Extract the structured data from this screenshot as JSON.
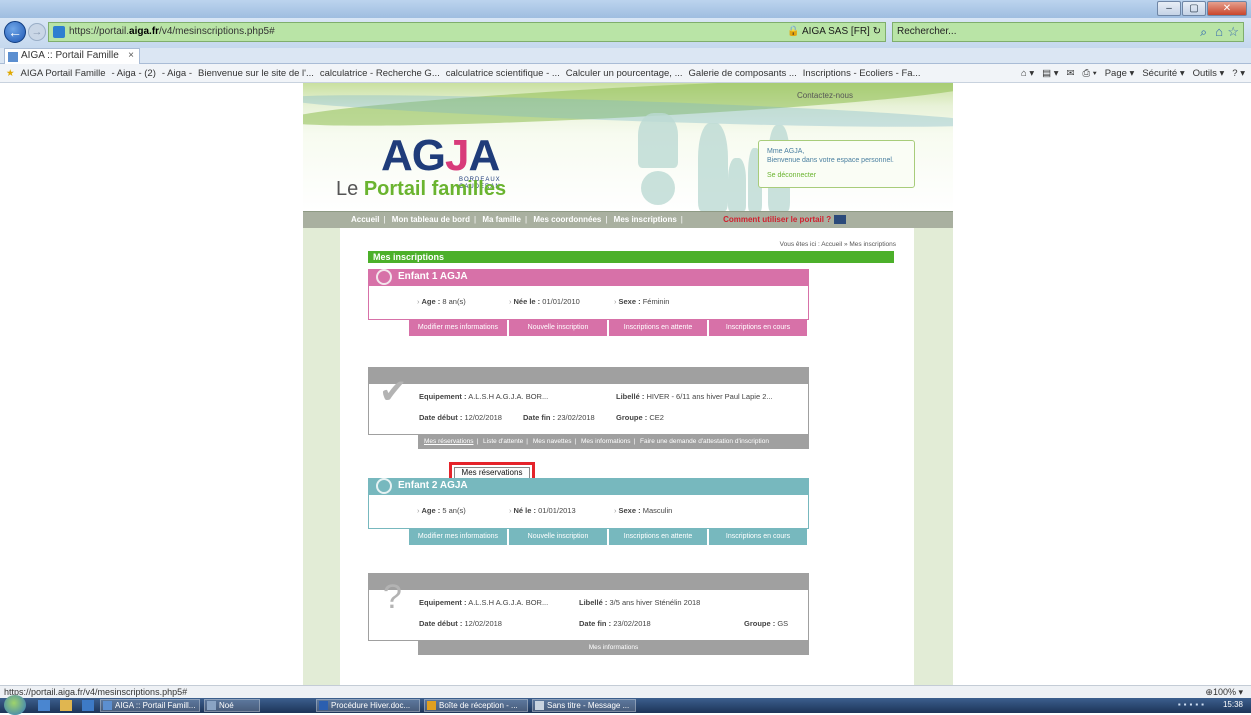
{
  "browser": {
    "url": "https://portail.aiga.fr/v4/mesinscriptions.php5#",
    "url_prefix": "https://portail.",
    "url_domain": "aiga.fr",
    "url_path": "/v4/mesinscriptions.php5#",
    "site_identity": "AIGA SAS [FR]",
    "search_placeholder": "Rechercher...",
    "tab_title": "AIGA :: Portail Famille",
    "tab_close": "×",
    "window_buttons": [
      "–",
      "▢",
      "✕"
    ],
    "favorites": [
      "AIGA Portail Famille",
      "- Aiga - (2)",
      "- Aiga -",
      "Bienvenue sur le site de l'...",
      "calculatrice - Recherche G...",
      "calculatrice scientifique - ...",
      "Calculer un pourcentage, ...",
      "Galerie de composants ...",
      "Inscriptions - Ecoliers - Fa..."
    ],
    "tools": [
      "Page ▾",
      "Sécurité ▾",
      "Outils ▾"
    ],
    "status_url": "https://portail.aiga.fr/v4/mesinscriptions.php5#",
    "zoom": "100%"
  },
  "site": {
    "contact": "Contactez-nous",
    "logo_main": "AG",
    "logo_j": "J",
    "logo_a": "A",
    "logo_sub1": "BORDEAUX",
    "logo_sub2": "CAUDERAN",
    "portal_prefix": "Le ",
    "portal_name": "Portail familles",
    "welcome_name": "Mme AGJA,",
    "welcome_text": "Bienvenue dans votre espace personnel.",
    "logout": "Se déconnecter",
    "menu": [
      "Accueil",
      "Mon tableau de bord",
      "Ma famille",
      "Mes coordonnées",
      "Mes inscriptions"
    ],
    "menu_sep": "|",
    "menu_help": "Comment utiliser le portail ?",
    "breadcrumb": "Vous êtes ici : Accueil » Mes inscriptions",
    "section_title": "Mes inscriptions"
  },
  "children": [
    {
      "name": "Enfant 1 AGJA",
      "age_label": "Age :",
      "age": "8 an(s)",
      "born_label": "Née le :",
      "born": "01/01/2010",
      "sex_label": "Sexe :",
      "sex": "Féminin",
      "tabs": [
        "Modifier mes informations",
        "Nouvelle inscription",
        "Inscriptions en attente",
        "Inscriptions en cours"
      ]
    },
    {
      "name": "Enfant 2 AGJA",
      "age_label": "Age :",
      "age": "5 an(s)",
      "born_label": "Né le :",
      "born": "01/01/2013",
      "sex_label": "Sexe :",
      "sex": "Masculin",
      "tabs": [
        "Modifier mes informations",
        "Nouvelle inscription",
        "Inscriptions en attente",
        "Inscriptions en cours"
      ]
    }
  ],
  "inscriptions": [
    {
      "equip_label": "Equipement :",
      "equip": "A.L.S.H A.G.J.A. BOR...",
      "libelle_label": "Libellé :",
      "libelle": "HIVER - 6/11 ans hiver Paul Lapie 2...",
      "start_label": "Date début :",
      "start": "12/02/2018",
      "end_label": "Date fin :",
      "end": "23/02/2018",
      "group_label": "Groupe :",
      "group": "CE2",
      "links": [
        "Mes réservations",
        "Liste d'attente",
        "Mes navettes",
        "Mes informations",
        "Faire une demande d'attestation d'inscription"
      ]
    },
    {
      "equip_label": "Equipement :",
      "equip": "A.L.S.H A.G.J.A. BOR...",
      "libelle_label": "Libellé :",
      "libelle": "3/5 ans hiver Sténélin 2018",
      "start_label": "Date début :",
      "start": "12/02/2018",
      "end_label": "Date fin :",
      "end": "23/02/2018",
      "group_label": "Groupe :",
      "group": "GS",
      "links": [
        "Mes informations"
      ]
    }
  ],
  "highlight_button": "Mes réservations",
  "taskbar": {
    "items": [
      "AIGA :: Portail Famill...",
      "Noé",
      "Procédure Hiver.doc...",
      "Boîte de réception - ...",
      "Sans titre - Message ..."
    ],
    "clock": "15:38"
  }
}
